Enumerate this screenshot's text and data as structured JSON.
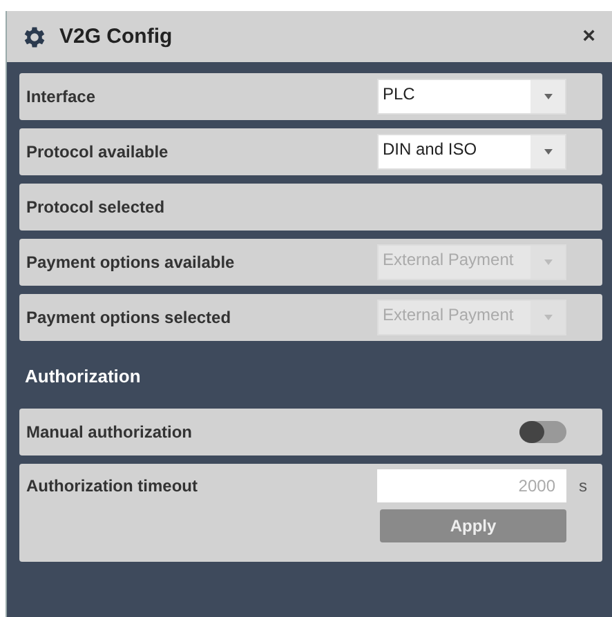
{
  "window": {
    "title": "V2G Config",
    "close": "×"
  },
  "rows": [
    {
      "kind": "select",
      "label": "Interface",
      "value": "PLC",
      "disabled": false
    },
    {
      "kind": "select",
      "label": "Protocol available",
      "value": "DIN and ISO",
      "disabled": false
    },
    {
      "kind": "text",
      "label": "Protocol selected"
    },
    {
      "kind": "select",
      "label": "Payment options available",
      "value": "External Payment",
      "disabled": true
    },
    {
      "kind": "select",
      "label": "Payment options selected",
      "value": "External Payment",
      "disabled": true
    }
  ],
  "section": "Authorization",
  "auth_rows": [
    {
      "kind": "toggle",
      "label": "Manual authorization",
      "on": false
    },
    {
      "kind": "timeout",
      "label": "Authorization timeout",
      "value": "2000",
      "unit": "s",
      "button": "Apply"
    }
  ]
}
